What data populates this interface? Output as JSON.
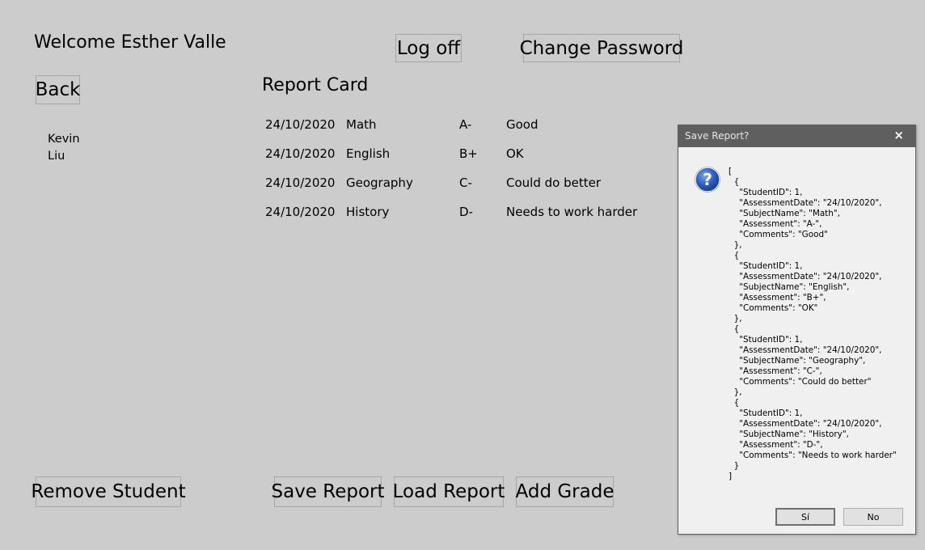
{
  "header": {
    "welcome": "Welcome Esther Valle",
    "logoff_label": "Log off",
    "change_password_label": "Change Password",
    "back_label": "Back"
  },
  "report": {
    "title": "Report Card",
    "rows": [
      {
        "date": "24/10/2020",
        "subject": "Math",
        "grade": "A-",
        "comment": "Good"
      },
      {
        "date": "24/10/2020",
        "subject": "English",
        "grade": "B+",
        "comment": "OK"
      },
      {
        "date": "24/10/2020",
        "subject": "Geography",
        "grade": "C-",
        "comment": "Could do better"
      },
      {
        "date": "24/10/2020",
        "subject": "History",
        "grade": "D-",
        "comment": "Needs to work harder"
      }
    ]
  },
  "students": [
    "Kevin",
    "Liu"
  ],
  "footer": {
    "remove_student_label": "Remove Student",
    "save_report_label": "Save Report",
    "load_report_label": "Load Report",
    "add_grade_label": "Add Grade"
  },
  "dialog": {
    "title": "Save Report?",
    "close_glyph": "×",
    "icon": "question-icon",
    "message": "[\n  {\n    \"StudentID\": 1,\n    \"AssessmentDate\": \"24/10/2020\",\n    \"SubjectName\": \"Math\",\n    \"Assessment\": \"A-\",\n    \"Comments\": \"Good\"\n  },\n  {\n    \"StudentID\": 1,\n    \"AssessmentDate\": \"24/10/2020\",\n    \"SubjectName\": \"English\",\n    \"Assessment\": \"B+\",\n    \"Comments\": \"OK\"\n  },\n  {\n    \"StudentID\": 1,\n    \"AssessmentDate\": \"24/10/2020\",\n    \"SubjectName\": \"Geography\",\n    \"Assessment\": \"C-\",\n    \"Comments\": \"Could do better\"\n  },\n  {\n    \"StudentID\": 1,\n    \"AssessmentDate\": \"24/10/2020\",\n    \"SubjectName\": \"History\",\n    \"Assessment\": \"D-\",\n    \"Comments\": \"Needs to work harder\"\n  }\n]",
    "yes_label": "Sí",
    "no_label": "No"
  },
  "colors": {
    "background": "#cccccc",
    "dialog_titlebar": "#5f5f5f",
    "dialog_body": "#f0f0f0",
    "icon_blue": "#1e4fa8"
  }
}
